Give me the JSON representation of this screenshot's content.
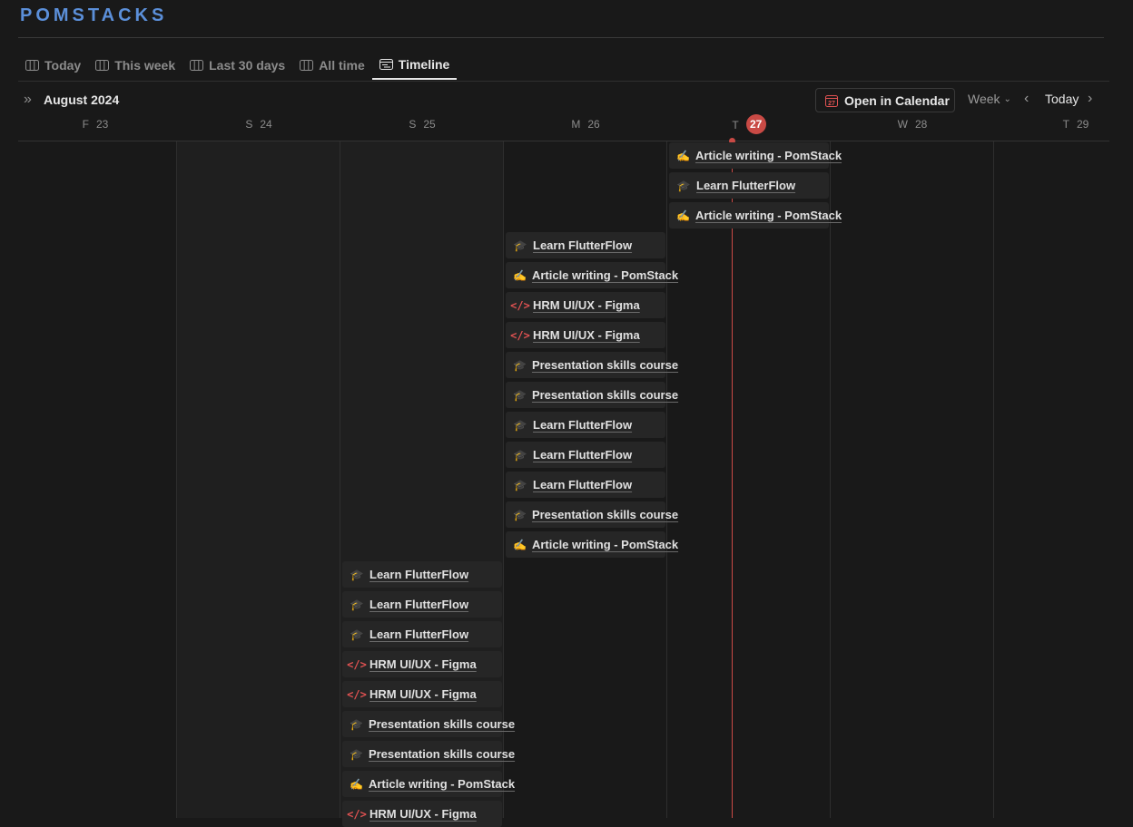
{
  "app": {
    "title": "POMSTACKS"
  },
  "tabs": [
    {
      "label": "Today",
      "icon": "columns-icon",
      "active": false
    },
    {
      "label": "This week",
      "icon": "columns-icon",
      "active": false
    },
    {
      "label": "Last 30 days",
      "icon": "columns-icon",
      "active": false
    },
    {
      "label": "All time",
      "icon": "columns-icon",
      "active": false
    },
    {
      "label": "Timeline",
      "icon": "timeline-icon",
      "active": true
    }
  ],
  "toolbar": {
    "month": "August 2024",
    "open_calendar": "Open in Calendar",
    "view": "Week",
    "today": "Today",
    "calendar_icon_day": "27"
  },
  "days": [
    {
      "letter": "F",
      "num": "23",
      "today": false
    },
    {
      "letter": "S",
      "num": "24",
      "today": false
    },
    {
      "letter": "S",
      "num": "25",
      "today": false
    },
    {
      "letter": "M",
      "num": "26",
      "today": false
    },
    {
      "letter": "T",
      "num": "27",
      "today": true
    },
    {
      "letter": "W",
      "num": "28",
      "today": false
    },
    {
      "letter": "T",
      "num": "29",
      "today": false
    }
  ],
  "events": [
    {
      "label": "Article writing - PomStack",
      "icon": "writing-hand-icon",
      "day": "27"
    },
    {
      "label": "Learn FlutterFlow",
      "icon": "graduation-cap-icon",
      "day": "27"
    },
    {
      "label": "Article writing - PomStack",
      "icon": "writing-hand-icon",
      "day": "27"
    },
    {
      "label": "Learn FlutterFlow",
      "icon": "graduation-cap-icon",
      "day": "26"
    },
    {
      "label": "Article writing - PomStack",
      "icon": "writing-hand-icon",
      "day": "26"
    },
    {
      "label": "HRM UI/UX - Figma",
      "icon": "code-icon",
      "day": "26"
    },
    {
      "label": "HRM UI/UX - Figma",
      "icon": "code-icon",
      "day": "26"
    },
    {
      "label": "Presentation skills course",
      "icon": "graduation-cap-icon",
      "day": "26"
    },
    {
      "label": "Presentation skills course",
      "icon": "graduation-cap-icon",
      "day": "26"
    },
    {
      "label": "Learn FlutterFlow",
      "icon": "graduation-cap-icon",
      "day": "26"
    },
    {
      "label": "Learn FlutterFlow",
      "icon": "graduation-cap-icon",
      "day": "26"
    },
    {
      "label": "Learn FlutterFlow",
      "icon": "graduation-cap-icon",
      "day": "26"
    },
    {
      "label": "Presentation skills course",
      "icon": "graduation-cap-icon",
      "day": "26"
    },
    {
      "label": "Article writing - PomStack",
      "icon": "writing-hand-icon",
      "day": "26"
    },
    {
      "label": "Learn FlutterFlow",
      "icon": "graduation-cap-icon",
      "day": "25"
    },
    {
      "label": "Learn FlutterFlow",
      "icon": "graduation-cap-icon",
      "day": "25"
    },
    {
      "label": "Learn FlutterFlow",
      "icon": "graduation-cap-icon",
      "day": "25"
    },
    {
      "label": "HRM UI/UX - Figma",
      "icon": "code-icon",
      "day": "25"
    },
    {
      "label": "HRM UI/UX - Figma",
      "icon": "code-icon",
      "day": "25"
    },
    {
      "label": "Presentation skills course",
      "icon": "graduation-cap-icon",
      "day": "25"
    },
    {
      "label": "Presentation skills course",
      "icon": "graduation-cap-icon",
      "day": "25"
    },
    {
      "label": "Article writing - PomStack",
      "icon": "writing-hand-icon",
      "day": "25"
    },
    {
      "label": "HRM UI/UX - Figma",
      "icon": "code-icon",
      "day": "25"
    }
  ],
  "colors": {
    "accent": "#5b8fd9",
    "today": "#c94a45",
    "background": "#191919",
    "event_bg": "#262626"
  }
}
